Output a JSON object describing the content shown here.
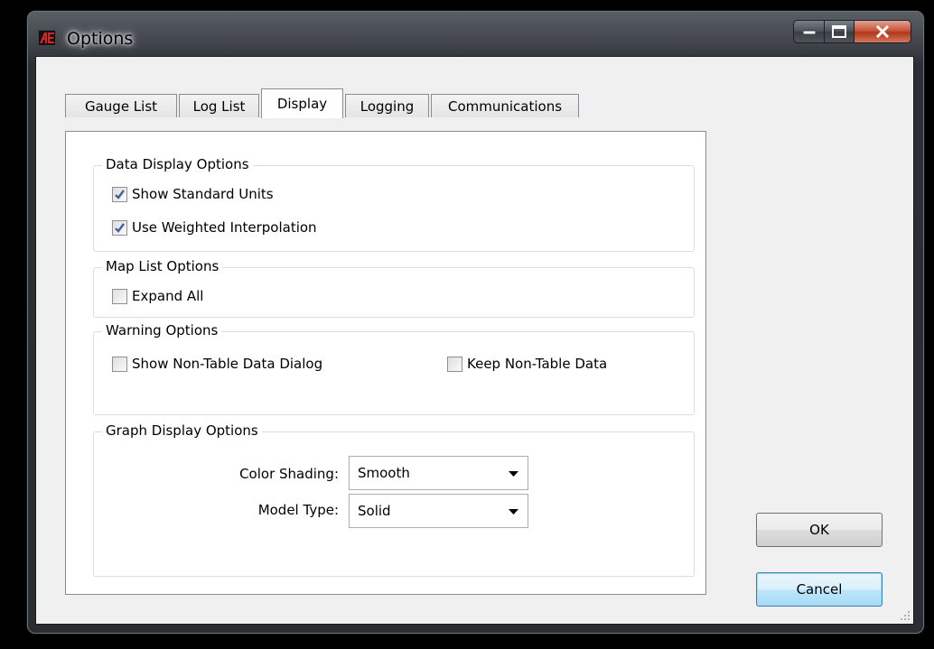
{
  "window": {
    "title": "Options",
    "caption_buttons": {
      "minimize": "minimize",
      "maximize": "maximize",
      "close": "close"
    }
  },
  "tabs": [
    {
      "label": "Gauge List"
    },
    {
      "label": "Log List"
    },
    {
      "label": "Display",
      "active": true
    },
    {
      "label": "Logging"
    },
    {
      "label": "Communications"
    }
  ],
  "data_display": {
    "title": "Data Display Options",
    "show_standard_units": {
      "label": "Show Standard Units",
      "checked": true
    },
    "use_weighted_interpolation": {
      "label": "Use Weighted Interpolation",
      "checked": true
    }
  },
  "map_list": {
    "title": "Map List Options",
    "expand_all": {
      "label": "Expand All",
      "checked": false
    }
  },
  "warning": {
    "title": "Warning Options",
    "show_non_table_dialog": {
      "label": "Show Non-Table Data Dialog",
      "checked": false
    },
    "keep_non_table_data": {
      "label": "Keep Non-Table Data",
      "checked": false
    }
  },
  "graph_display": {
    "title": "Graph Display Options",
    "color_shading": {
      "label": "Color Shading:",
      "value": "Smooth"
    },
    "model_type": {
      "label": "Model Type:",
      "value": "Solid"
    }
  },
  "buttons": {
    "ok": "OK",
    "cancel": "Cancel"
  },
  "colors": {
    "close_button": "#c8553d",
    "focus_blue": "#3c7fb1",
    "app_icon_red": "#e02020"
  }
}
